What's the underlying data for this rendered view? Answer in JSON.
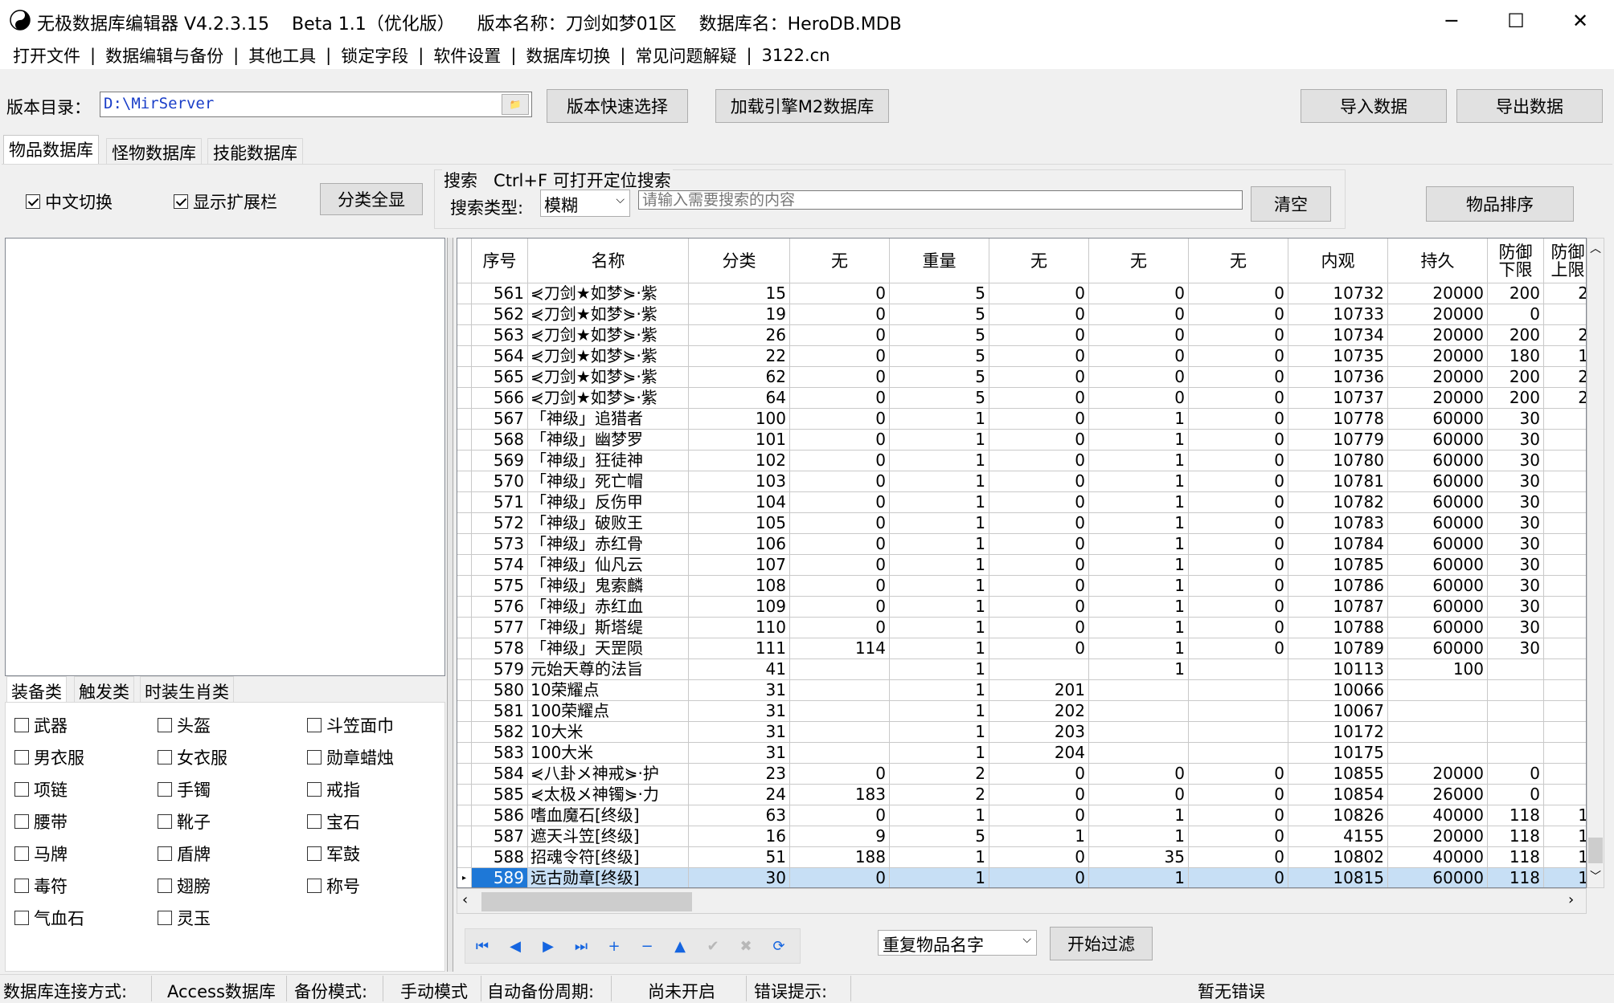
{
  "window": {
    "title": "无极数据库编辑器 V4.2.3.15    Beta 1.1（优化版）    版本名称：刀剑如梦01区    数据库名：HeroDB.MDB",
    "minimize": "─",
    "maximize": "☐",
    "close": "✕"
  },
  "menu": [
    "打开文件",
    "数据编辑与备份",
    "其他工具",
    "锁定字段",
    "软件设置",
    "数据库切换",
    "常见问题解疑",
    "3122.cn"
  ],
  "menu_sep": "|",
  "toolbar": {
    "dir_label": "版本目录：",
    "dir_value": "D:\\MirServer",
    "browse": "📁",
    "quick_select": "版本快速选择",
    "load_m2": "加载引擎M2数据库",
    "import": "导入数据",
    "export": "导出数据"
  },
  "tabs": [
    "物品数据库",
    "怪物数据库",
    "技能数据库"
  ],
  "options": {
    "chinese_switch": "中文切换",
    "show_ext": "显示扩展栏",
    "show_all": "分类全显",
    "search_title": "搜索   Ctrl+F 可打开定位搜索",
    "search_type_label": "搜索类型:",
    "search_type_value": "模糊",
    "search_placeholder": "请输入需要搜索的内容",
    "clear": "清空",
    "sort": "物品排序"
  },
  "category_tabs": [
    "装备类",
    "触发类",
    "时装生肖类"
  ],
  "categories": [
    "武器",
    "头盔",
    "斗笠面巾",
    "男衣服",
    "女衣服",
    "勋章蜡烛",
    "项链",
    "手镯",
    "戒指",
    "腰带",
    "靴子",
    "宝石",
    "马牌",
    "盾牌",
    "军鼓",
    "毒符",
    "翅膀",
    "称号",
    "气血石",
    "灵玉"
  ],
  "grid": {
    "columns": [
      "序号",
      "名称",
      "分类",
      "无",
      "重量",
      "无",
      "无",
      "无",
      "内观",
      "持久",
      "防御\n下限",
      "防御\n上限"
    ],
    "rows": [
      [
        "561",
        "⋞刀剑★如梦⋟·紫",
        "15",
        "0",
        "5",
        "0",
        "0",
        "0",
        "10732",
        "20000",
        "200",
        "2"
      ],
      [
        "562",
        "⋞刀剑★如梦⋟·紫",
        "19",
        "0",
        "5",
        "0",
        "0",
        "0",
        "10733",
        "20000",
        "0",
        ""
      ],
      [
        "563",
        "⋞刀剑★如梦⋟·紫",
        "26",
        "0",
        "5",
        "0",
        "0",
        "0",
        "10734",
        "20000",
        "200",
        "2"
      ],
      [
        "564",
        "⋞刀剑★如梦⋟·紫",
        "22",
        "0",
        "5",
        "0",
        "0",
        "0",
        "10735",
        "20000",
        "180",
        "1"
      ],
      [
        "565",
        "⋞刀剑★如梦⋟·紫",
        "62",
        "0",
        "5",
        "0",
        "0",
        "0",
        "10736",
        "20000",
        "200",
        "2"
      ],
      [
        "566",
        "⋞刀剑★如梦⋟·紫",
        "64",
        "0",
        "5",
        "0",
        "0",
        "0",
        "10737",
        "20000",
        "200",
        "2"
      ],
      [
        "567",
        "「神级」追猎者",
        "100",
        "0",
        "1",
        "0",
        "1",
        "0",
        "10778",
        "60000",
        "30",
        ""
      ],
      [
        "568",
        "「神级」幽梦罗",
        "101",
        "0",
        "1",
        "0",
        "1",
        "0",
        "10779",
        "60000",
        "30",
        ""
      ],
      [
        "569",
        "「神级」狂徒神",
        "102",
        "0",
        "1",
        "0",
        "1",
        "0",
        "10780",
        "60000",
        "30",
        ""
      ],
      [
        "570",
        "「神级」死亡帽",
        "103",
        "0",
        "1",
        "0",
        "1",
        "0",
        "10781",
        "60000",
        "30",
        ""
      ],
      [
        "571",
        "「神级」反伤甲",
        "104",
        "0",
        "1",
        "0",
        "1",
        "0",
        "10782",
        "60000",
        "30",
        ""
      ],
      [
        "572",
        "「神级」破败王",
        "105",
        "0",
        "1",
        "0",
        "1",
        "0",
        "10783",
        "60000",
        "30",
        ""
      ],
      [
        "573",
        "「神级」赤红骨",
        "106",
        "0",
        "1",
        "0",
        "1",
        "0",
        "10784",
        "60000",
        "30",
        ""
      ],
      [
        "574",
        "「神级」仙凡云",
        "107",
        "0",
        "1",
        "0",
        "1",
        "0",
        "10785",
        "60000",
        "30",
        ""
      ],
      [
        "575",
        "「神级」鬼索麟",
        "108",
        "0",
        "1",
        "0",
        "1",
        "0",
        "10786",
        "60000",
        "30",
        ""
      ],
      [
        "576",
        "「神级」赤红血",
        "109",
        "0",
        "1",
        "0",
        "1",
        "0",
        "10787",
        "60000",
        "30",
        ""
      ],
      [
        "577",
        "「神级」斯塔缇",
        "110",
        "0",
        "1",
        "0",
        "1",
        "0",
        "10788",
        "60000",
        "30",
        ""
      ],
      [
        "578",
        "「神级」天罡陨",
        "111",
        "114",
        "1",
        "0",
        "1",
        "0",
        "10789",
        "60000",
        "30",
        ""
      ],
      [
        "579",
        "元始天尊的法旨",
        "41",
        "",
        "1",
        "",
        "1",
        "",
        "10113",
        "100",
        "",
        ""
      ],
      [
        "580",
        "10荣耀点",
        "31",
        "",
        "1",
        "201",
        "",
        "",
        "10066",
        "",
        "",
        ""
      ],
      [
        "581",
        "100荣耀点",
        "31",
        "",
        "1",
        "202",
        "",
        "",
        "10067",
        "",
        "",
        ""
      ],
      [
        "582",
        "10大米",
        "31",
        "",
        "1",
        "203",
        "",
        "",
        "10172",
        "",
        "",
        ""
      ],
      [
        "583",
        "100大米",
        "31",
        "",
        "1",
        "204",
        "",
        "",
        "10175",
        "",
        "",
        ""
      ],
      [
        "584",
        "⋞八卦メ神戒⋟·护",
        "23",
        "0",
        "2",
        "0",
        "0",
        "0",
        "10855",
        "20000",
        "0",
        ""
      ],
      [
        "585",
        "⋞太极メ神镯⋟·力",
        "24",
        "183",
        "2",
        "0",
        "0",
        "0",
        "10854",
        "26000",
        "0",
        ""
      ],
      [
        "586",
        "嗜血魔石[终级]",
        "63",
        "0",
        "1",
        "0",
        "1",
        "0",
        "10826",
        "40000",
        "118",
        "1"
      ],
      [
        "587",
        "遮天斗笠[终级]",
        "16",
        "9",
        "5",
        "1",
        "1",
        "0",
        "4155",
        "20000",
        "118",
        "1"
      ],
      [
        "588",
        "招魂令符[终级]",
        "51",
        "188",
        "1",
        "0",
        "35",
        "0",
        "10802",
        "40000",
        "118",
        "1"
      ],
      [
        "589",
        "远古勋章[终级]",
        "30",
        "0",
        "1",
        "0",
        "1",
        "0",
        "10815",
        "60000",
        "118",
        "1"
      ]
    ],
    "selected_row": "589"
  },
  "nav_buttons": [
    "⏮",
    "◀",
    "▶",
    "⏭",
    "+",
    "−",
    "▲",
    "✔",
    "✖",
    "⟳"
  ],
  "filter": {
    "select_value": "重复物品名字",
    "start": "开始过滤"
  },
  "status": {
    "conn_label": "数据库连接方式:",
    "conn_value": "Access数据库",
    "backup_label": "备份模式:",
    "backup_value": "手动模式",
    "auto_label": "自动备份周期:",
    "auto_value": "尚未开启",
    "error_label": "错误提示:",
    "error_value": "暂无错误"
  }
}
